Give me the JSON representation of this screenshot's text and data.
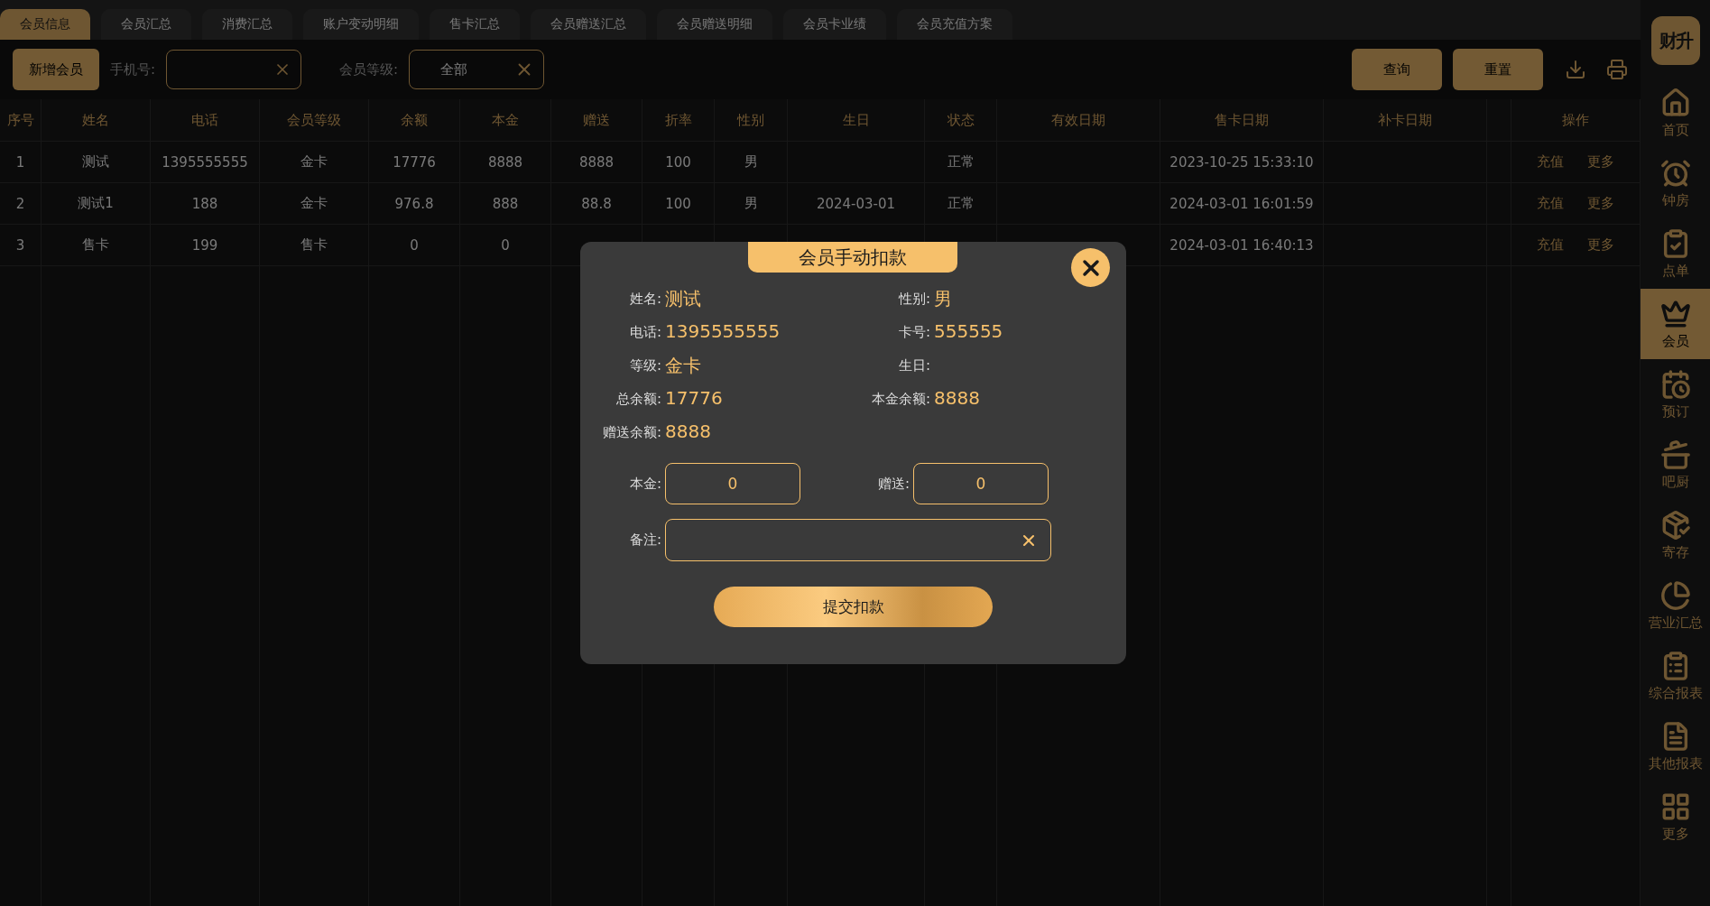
{
  "tabs": [
    {
      "label": "会员信息",
      "selected": true
    },
    {
      "label": "会员汇总",
      "selected": false
    },
    {
      "label": "消费汇总",
      "selected": false
    },
    {
      "label": "账户变动明细",
      "selected": false
    },
    {
      "label": "售卡汇总",
      "selected": false
    },
    {
      "label": "会员赠送汇总",
      "selected": false
    },
    {
      "label": "会员赠送明细",
      "selected": false
    },
    {
      "label": "会员卡业绩",
      "selected": false
    },
    {
      "label": "会员充值方案",
      "selected": false
    }
  ],
  "toolbar": {
    "add_button": "新增会员",
    "phone_label": "手机号:",
    "level_label": "会员等级:",
    "level_field": {
      "value": "全部"
    },
    "buttons": [
      "查询",
      "重置"
    ]
  },
  "table": {
    "columns": [
      "序号",
      "姓名",
      "电话",
      "会员等级",
      "余额",
      "本金",
      "赠送",
      "折率",
      "性别",
      "生日",
      "状态",
      "有效日期",
      "售卡日期",
      "补卡日期",
      "",
      "操作"
    ],
    "rows": [
      {
        "cells": [
          "1",
          "测试",
          "1395555555",
          "金卡",
          "17776",
          "8888",
          "8888",
          "100",
          "男",
          "",
          "正常",
          "",
          "2023-10-25 15:33:10",
          "",
          ""
        ],
        "actions": [
          "充值",
          "更多"
        ]
      },
      {
        "cells": [
          "2",
          "测试1",
          "188",
          "金卡",
          "976.8",
          "888",
          "88.8",
          "100",
          "男",
          "2024-03-01",
          "正常",
          "",
          "2024-03-01 16:01:59",
          "",
          ""
        ],
        "actions": [
          "充值",
          "更多"
        ]
      },
      {
        "cells": [
          "3",
          "售卡",
          "199",
          "售卡",
          "0",
          "0",
          "",
          "",
          "",
          "",
          "",
          "",
          "2024-03-01 16:40:13",
          "",
          ""
        ],
        "actions": [
          "充值",
          "更多"
        ]
      }
    ]
  },
  "sidebar": {
    "logo": "财升",
    "items": [
      {
        "label": "首页",
        "selected": false
      },
      {
        "label": "钟房",
        "selected": false
      },
      {
        "label": "点单",
        "selected": false
      },
      {
        "label": "会员",
        "selected": true
      },
      {
        "label": "预订",
        "selected": false
      },
      {
        "label": "吧厨",
        "selected": false
      },
      {
        "label": "寄存",
        "selected": false
      },
      {
        "label": "营业汇总",
        "selected": false
      },
      {
        "label": "综合报表",
        "selected": false
      },
      {
        "label": "其他报表",
        "selected": false
      },
      {
        "label": "更多",
        "selected": false
      }
    ]
  },
  "dialog": {
    "title": "会员手动扣款",
    "info": [
      {
        "label": "姓名:",
        "value": "测试"
      },
      {
        "label": "性别:",
        "value": "男"
      },
      {
        "label": "电话:",
        "value": "1395555555"
      },
      {
        "label": "卡号:",
        "value": "555555"
      },
      {
        "label": "等级:",
        "value": "金卡"
      },
      {
        "label": "生日:"
      },
      {
        "label": "总余额:",
        "value": "17776"
      },
      {
        "label": "本金余额:",
        "value": "8888"
      },
      {
        "label": "赠送余额:",
        "value": "8888"
      }
    ],
    "principal": {
      "label": "本金:",
      "value": "0"
    },
    "gift": {
      "label": "赠送:",
      "value": "0"
    },
    "remark": {
      "label": "备注:"
    },
    "submit": "提交扣款"
  }
}
